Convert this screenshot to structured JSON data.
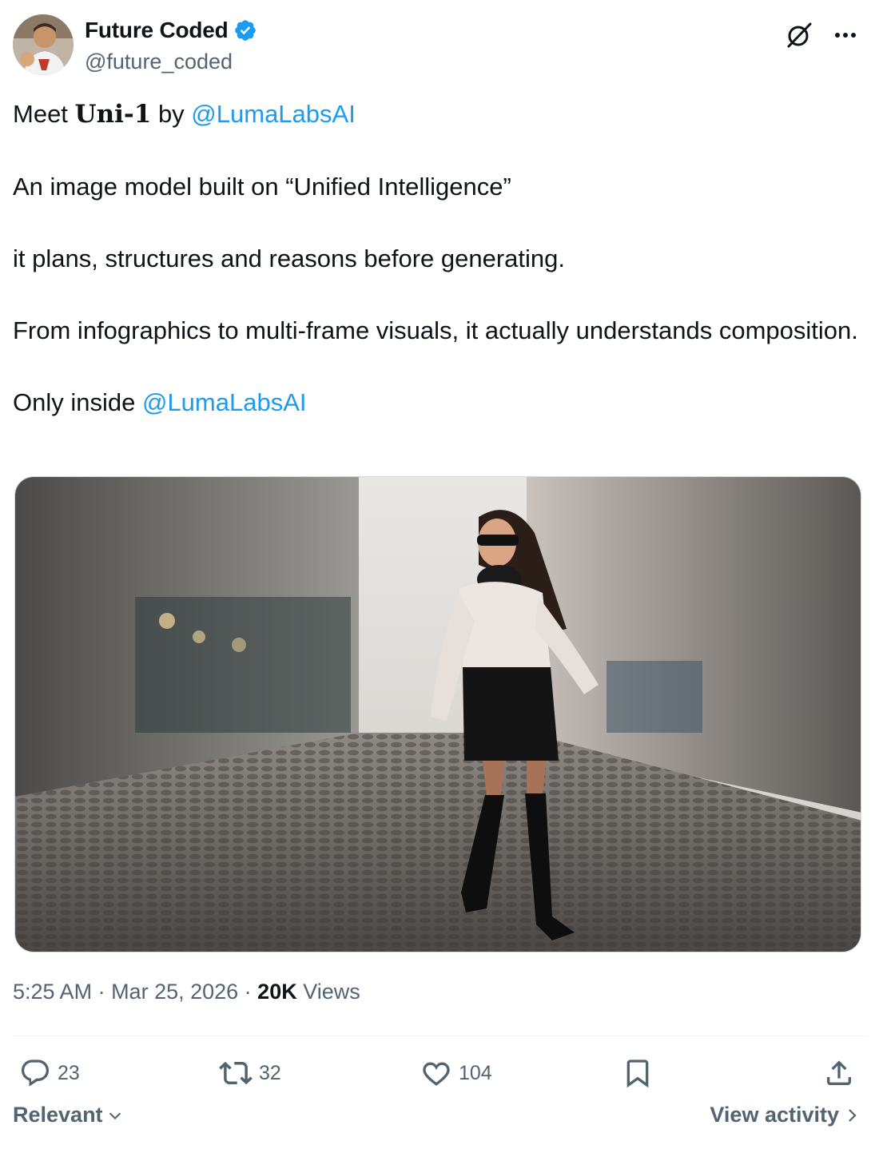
{
  "author": {
    "display_name": "Future Coded",
    "handle": "@future_coded"
  },
  "tweet": {
    "line1_prefix": "Meet ",
    "line1_bold": "𝐔𝐧𝐢-𝟏",
    "line1_by": " by ",
    "line1_mention": "@LumaLabsAI",
    "para2": "An image model built on “Unified Intelligence”",
    "para3": "it plans, structures and reasons before generating.",
    "para4": "From infographics to multi-frame visuals, it actually understands composition.",
    "para5_prefix": "Only inside ",
    "para5_mention": "@LumaLabsAI"
  },
  "meta": {
    "time": "5:25 AM",
    "sep1": " · ",
    "date": "Mar 25, 2026",
    "sep2": " · ",
    "views_count": "20K",
    "views_label": " Views"
  },
  "actions": {
    "replies": "23",
    "reposts": "32",
    "likes": "104"
  },
  "footer": {
    "sort_label": "Relevant",
    "activity_label": "View activity"
  },
  "colors": {
    "link": "#1d9bf0",
    "secondary_text": "#536471",
    "primary_text": "#0f1419"
  },
  "icons": {
    "verified": "verified-badge-icon",
    "grok": "grok-icon",
    "more": "more-icon",
    "reply": "reply-icon",
    "repost": "repost-icon",
    "like": "like-icon",
    "bookmark": "bookmark-icon",
    "share": "share-icon"
  }
}
